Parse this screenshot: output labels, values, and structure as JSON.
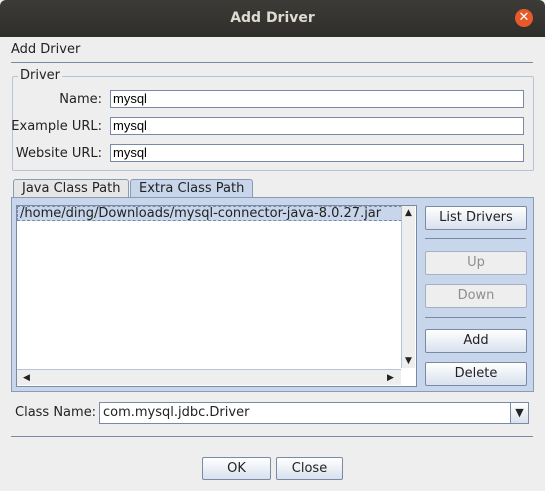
{
  "window": {
    "title": "Add Driver"
  },
  "header": {
    "label": "Add Driver"
  },
  "driver_group": {
    "title": "Driver",
    "name_label": "Name:",
    "name_value": "mysql",
    "example_url_label": "Example URL:",
    "example_url_value": "mysql",
    "website_url_label": "Website URL:",
    "website_url_value": "mysql"
  },
  "tabs": [
    {
      "label": "Java Class Path",
      "active": false
    },
    {
      "label": "Extra Class Path",
      "active": true
    }
  ],
  "class_path_list": {
    "items": [
      "/home/ding/Downloads/mysql-connector-java-8.0.27.jar"
    ],
    "selected_index": 0
  },
  "side_buttons": {
    "list_drivers": "List Drivers",
    "up": "Up",
    "down": "Down",
    "add": "Add",
    "delete": "Delete"
  },
  "class_name": {
    "label": "Class Name:",
    "value": "com.mysql.jdbc.Driver"
  },
  "footer": {
    "ok": "OK",
    "close": "Close"
  },
  "icons": {
    "close": "close-icon",
    "scroll_up": "arrow-up-icon",
    "scroll_down": "arrow-down-icon",
    "scroll_left": "arrow-left-icon",
    "scroll_right": "arrow-right-icon",
    "dropdown": "chevron-down-icon"
  },
  "colors": {
    "titlebar": "#3c3b37",
    "close_button": "#e8592a",
    "selection": "#c7d6ea"
  }
}
